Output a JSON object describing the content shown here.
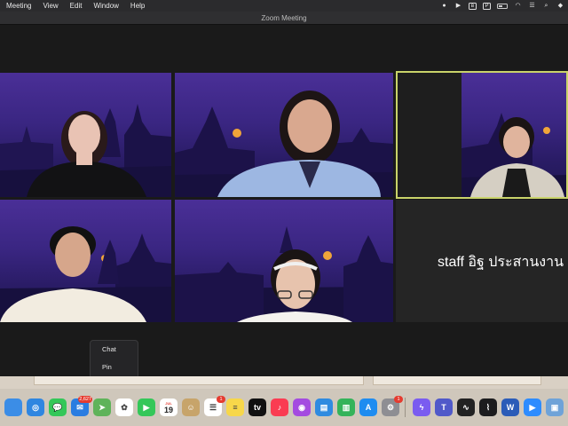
{
  "menubar": {
    "items": [
      "Meeting",
      "View",
      "Edit",
      "Window",
      "Help"
    ],
    "status_icons": [
      "record-icon",
      "play-icon",
      "bluetooth-icon",
      "p-icon",
      "wifi-icon",
      "control-center-icon",
      "search-icon",
      "siri-icon"
    ]
  },
  "window": {
    "title": "Zoom Meeting"
  },
  "participants": {
    "tile6_name": "staff อิฐ ประสานงาน"
  },
  "context_menu": {
    "items": [
      "Chat",
      "Pin"
    ]
  },
  "dock": {
    "apps": [
      {
        "name": "finder",
        "color": "#3b8de6",
        "glyph": ""
      },
      {
        "name": "safari",
        "color": "#2f86e0",
        "glyph": "◎"
      },
      {
        "name": "messages",
        "color": "#34c759",
        "glyph": "💬"
      },
      {
        "name": "mail",
        "color": "#2a7de1",
        "glyph": "✉",
        "badge": "2,627"
      },
      {
        "name": "maps",
        "color": "#5fb35a",
        "glyph": "➤"
      },
      {
        "name": "photos",
        "color": "#ffffff",
        "glyph": "✿"
      },
      {
        "name": "facetime",
        "color": "#34c759",
        "glyph": "▶"
      },
      {
        "name": "calendar",
        "month": "JUL",
        "day": "19"
      },
      {
        "name": "contacts",
        "color": "#c7a46a",
        "glyph": "☺"
      },
      {
        "name": "reminders",
        "color": "#ffffff",
        "glyph": "☰",
        "badge": "1"
      },
      {
        "name": "notes",
        "color": "#f7d74a",
        "glyph": "≡"
      },
      {
        "name": "apple-tv",
        "color": "#111111",
        "glyph": "tv"
      },
      {
        "name": "music",
        "color": "#fa3c52",
        "glyph": "♪"
      },
      {
        "name": "podcasts",
        "color": "#a44be0",
        "glyph": "◉"
      },
      {
        "name": "keynote",
        "color": "#2f8be0",
        "glyph": "▤"
      },
      {
        "name": "numbers",
        "color": "#34b35a",
        "glyph": "▥"
      },
      {
        "name": "app-store",
        "color": "#1e8cf0",
        "glyph": "A"
      },
      {
        "name": "system-preferences",
        "color": "#8e8e93",
        "glyph": "⚙",
        "badge": "1"
      },
      {
        "name": "messenger",
        "color": "#7a5cf0",
        "glyph": "ϟ"
      },
      {
        "name": "teams",
        "color": "#5059c9",
        "glyph": "T"
      },
      {
        "name": "activity-monitor",
        "color": "#222222",
        "glyph": "∿"
      },
      {
        "name": "stocks",
        "color": "#1c1c1e",
        "glyph": "⌇"
      },
      {
        "name": "word",
        "color": "#2b5cb8",
        "glyph": "W"
      },
      {
        "name": "zoom",
        "color": "#2d8cff",
        "glyph": "▶"
      },
      {
        "name": "preview",
        "color": "#6fa3d8",
        "glyph": "▣"
      },
      {
        "name": "more",
        "color": "#2b2b2b",
        "glyph": "⋮"
      }
    ]
  }
}
